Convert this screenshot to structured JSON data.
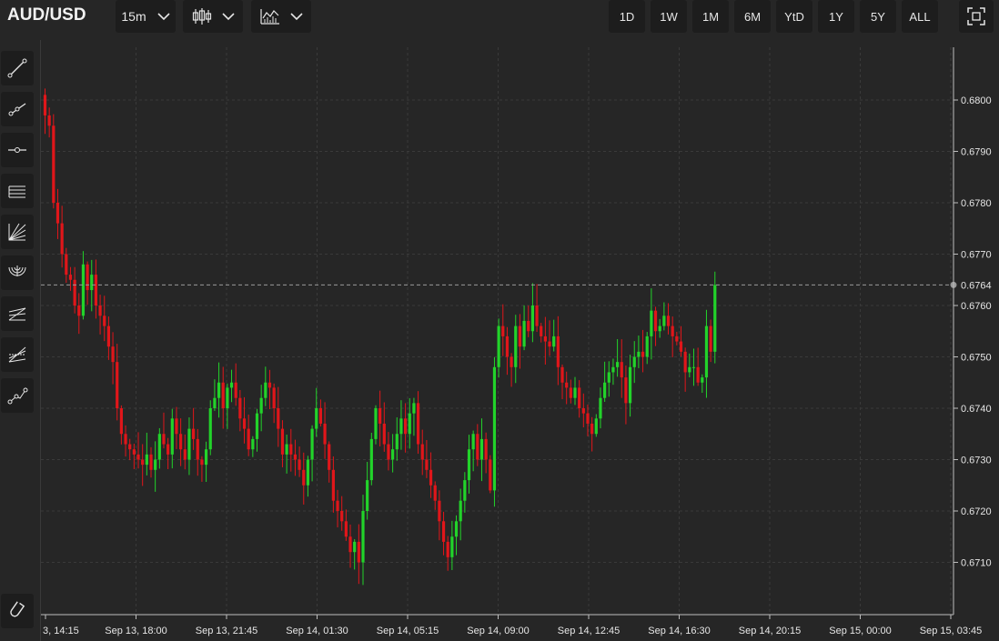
{
  "header": {
    "symbol": "AUD/USD",
    "interval": "15m",
    "ranges": [
      "1D",
      "1W",
      "1M",
      "6M",
      "YtD",
      "1Y",
      "5Y",
      "ALL"
    ]
  },
  "icons": {
    "chart_type": "candlestick-icon",
    "indicators": "indicators-icon",
    "fullscreen": "fullscreen-icon",
    "tools": [
      "trend-line-icon",
      "ray-icon",
      "horizontal-line-icon",
      "parallel-channel-icon",
      "fan-icon",
      "arc-icon",
      "fib-retracement-icon",
      "fib-extension-icon",
      "polyline-icon"
    ],
    "magnet": "magnet-icon"
  },
  "colors": {
    "up": "#22d32a",
    "down": "#e0161a",
    "grid": "#3a3a3a",
    "background": "#262626"
  },
  "chart_data": {
    "type": "candlestick",
    "y_ticks": [
      "0.6800",
      "0.6790",
      "0.6780",
      "0.6770",
      "0.6760",
      "0.6750",
      "0.6740",
      "0.6730",
      "0.6720",
      "0.6710"
    ],
    "x_ticks": [
      "3, 14:15",
      "Sep 13, 18:00",
      "Sep 13, 21:45",
      "Sep 14, 01:30",
      "Sep 14, 05:15",
      "Sep 14, 09:00",
      "Sep 14, 12:45",
      "Sep 14, 16:30",
      "Sep 14, 20:15",
      "Sep 15, 00:00",
      "Sep 15, 03:45"
    ],
    "last_price": "0.6764",
    "ylim": [
      0.6704,
      0.681
    ],
    "grid": true,
    "closes": [
      0.6797,
      0.6795,
      0.678,
      0.6776,
      0.677,
      0.6766,
      0.6765,
      0.676,
      0.6758,
      0.6768,
      0.6763,
      0.6766,
      0.676,
      0.6758,
      0.6756,
      0.6752,
      0.6749,
      0.674,
      0.6735,
      0.6733,
      0.6732,
      0.6731,
      0.673,
      0.6729,
      0.6731,
      0.6728,
      0.673,
      0.6735,
      0.6733,
      0.6731,
      0.6738,
      0.6735,
      0.6732,
      0.673,
      0.6736,
      0.6734,
      0.673,
      0.6729,
      0.6732,
      0.674,
      0.6742,
      0.6745,
      0.674,
      0.6744,
      0.6745,
      0.6742,
      0.6738,
      0.6736,
      0.6732,
      0.6734,
      0.6739,
      0.6742,
      0.6745,
      0.6744,
      0.674,
      0.6736,
      0.6731,
      0.6733,
      0.6731,
      0.673,
      0.6728,
      0.6725,
      0.673,
      0.6736,
      0.674,
      0.6737,
      0.6733,
      0.6728,
      0.6722,
      0.672,
      0.6718,
      0.6715,
      0.6712,
      0.6714,
      0.671,
      0.672,
      0.6726,
      0.6734,
      0.674,
      0.6737,
      0.6733,
      0.673,
      0.6732,
      0.6735,
      0.6738,
      0.6735,
      0.6739,
      0.6741,
      0.6733,
      0.673,
      0.6728,
      0.6725,
      0.6722,
      0.6718,
      0.6714,
      0.6711,
      0.6715,
      0.6718,
      0.6722,
      0.6726,
      0.6732,
      0.6735,
      0.673,
      0.6734,
      0.673,
      0.6724,
      0.6748,
      0.6756,
      0.6754,
      0.675,
      0.6748,
      0.6756,
      0.6752,
      0.6757,
      0.6755,
      0.676,
      0.6756,
      0.6754,
      0.6753,
      0.6752,
      0.6754,
      0.6748,
      0.6745,
      0.6744,
      0.6742,
      0.6744,
      0.674,
      0.6739,
      0.6737,
      0.6735,
      0.6738,
      0.6742,
      0.6745,
      0.6747,
      0.6748,
      0.6749,
      0.6746,
      0.6741,
      0.6748,
      0.675,
      0.6751,
      0.675,
      0.6754,
      0.6759,
      0.6755,
      0.6756,
      0.6758,
      0.6756,
      0.6754,
      0.6753,
      0.6751,
      0.6747,
      0.6748,
      0.6748,
      0.6745,
      0.6746,
      0.6756,
      0.6751,
      0.6764
    ]
  }
}
